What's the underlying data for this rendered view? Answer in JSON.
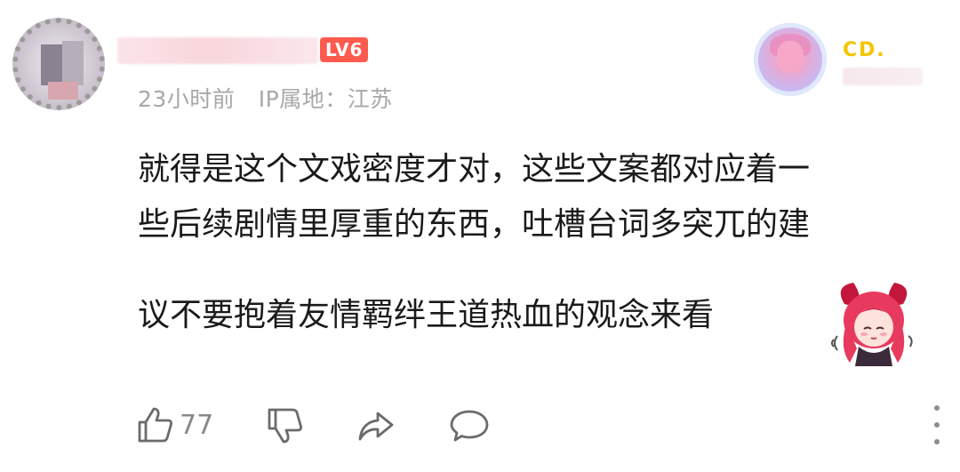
{
  "comment": {
    "level_badge": "LV6",
    "time": "23小时前",
    "ip_location": "IP属地：江苏",
    "pendant_label": "CD.",
    "text_lines": [
      "就得是这个文戏密度才对，这些文案都对应着一",
      "些后续剧情里厚重的东西，吐槽台词多突兀的建",
      "议不要抱着友情羁绊王道热血的观念来看"
    ]
  },
  "actions": {
    "like_count": "77"
  },
  "icons": {
    "like": "thumbs-up-icon",
    "dislike": "thumbs-down-icon",
    "share": "share-icon",
    "reply": "comment-icon",
    "more": "more-vertical-icon"
  },
  "colors": {
    "level_badge": "#ff5a4e",
    "meta_text": "#a8a8a8",
    "pendant_label": "#f3c400"
  }
}
